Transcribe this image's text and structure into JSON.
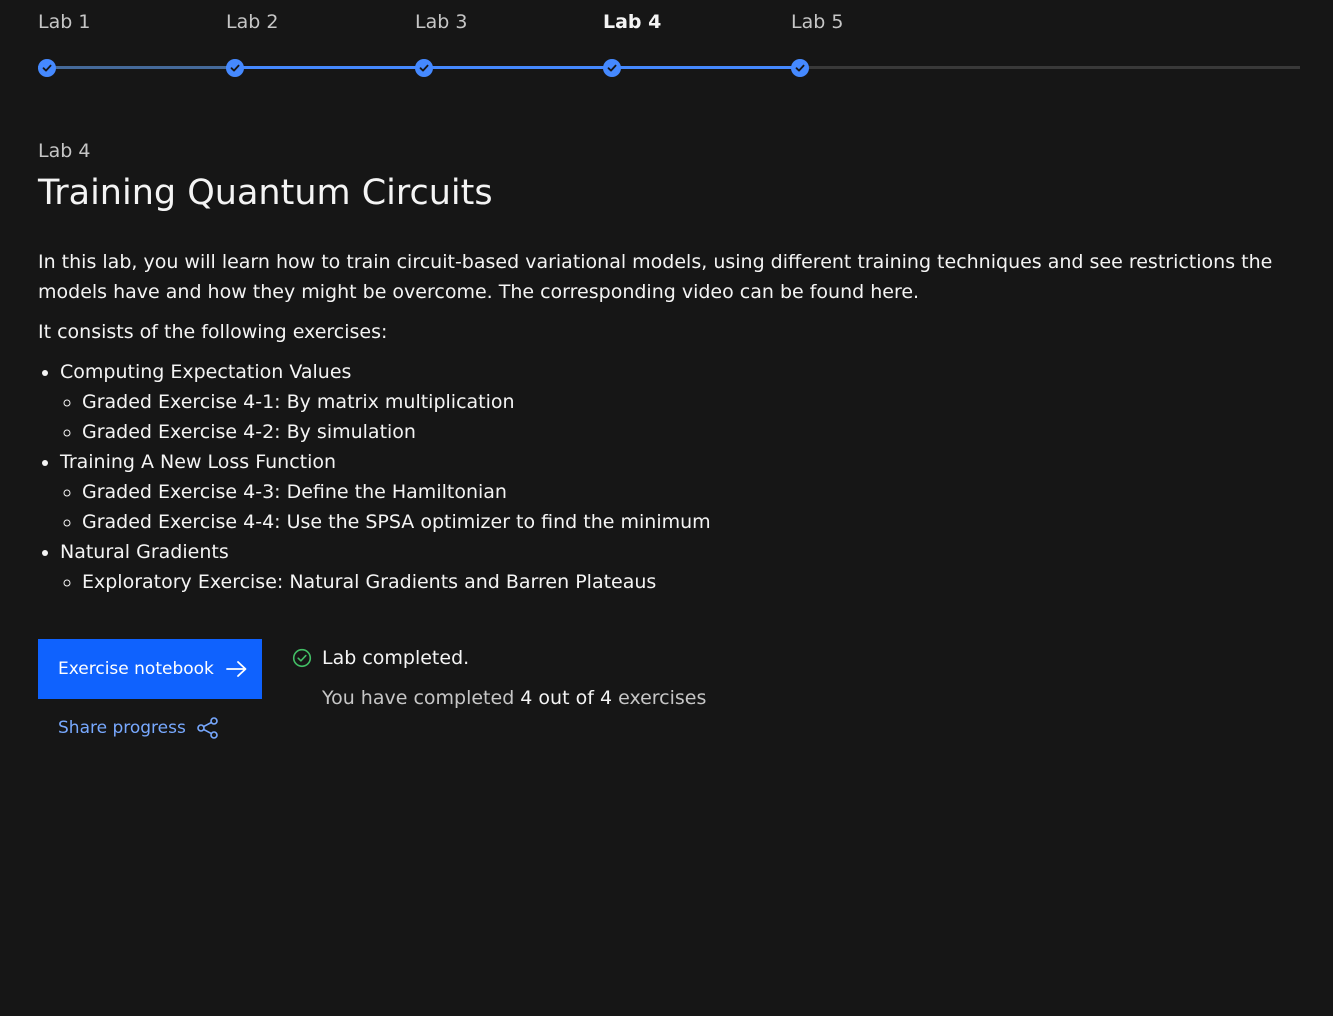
{
  "stepper": {
    "steps": [
      {
        "label": "Lab 1",
        "completed": true,
        "current": false
      },
      {
        "label": "Lab 2",
        "completed": true,
        "current": false
      },
      {
        "label": "Lab 3",
        "completed": true,
        "current": false
      },
      {
        "label": "Lab 4",
        "completed": true,
        "current": true
      },
      {
        "label": "Lab 5",
        "completed": true,
        "current": false
      }
    ],
    "accent_color": "#4589ff"
  },
  "lab": {
    "eyebrow": "Lab 4",
    "title": "Training Quantum Circuits",
    "intro": "In this lab, you will learn how to train circuit-based variational models, using different training techniques and see restrictions the models have and how they might be overcome. The corresponding video can be found here.",
    "exercises_intro": "It consists of the following exercises:",
    "sections": [
      {
        "title": "Computing Expectation Values",
        "items": [
          "Graded Exercise 4-1: By matrix multiplication",
          "Graded Exercise 4-2: By simulation"
        ]
      },
      {
        "title": "Training A New Loss Function",
        "items": [
          "Graded Exercise 4-3: Define the Hamiltonian",
          "Graded Exercise 4-4: Use the SPSA optimizer to find the minimum"
        ]
      },
      {
        "title": "Natural Gradients",
        "items": [
          "Exploratory Exercise: Natural Gradients and Barren Plateaus"
        ]
      }
    ]
  },
  "actions": {
    "notebook_label": "Exercise notebook",
    "notebook_icon": "arrow-right-icon",
    "share_label": "Share progress",
    "share_icon": "share-icon",
    "button_color": "#0f62fe",
    "link_color": "#78a9ff"
  },
  "status": {
    "icon": "checkmark-outline-icon",
    "icon_color": "#42be65",
    "title": "Lab completed.",
    "detail_prefix": "You have completed ",
    "completed_count": "4",
    "detail_middle": " out of ",
    "total_count": "4",
    "detail_suffix": " exercises"
  }
}
